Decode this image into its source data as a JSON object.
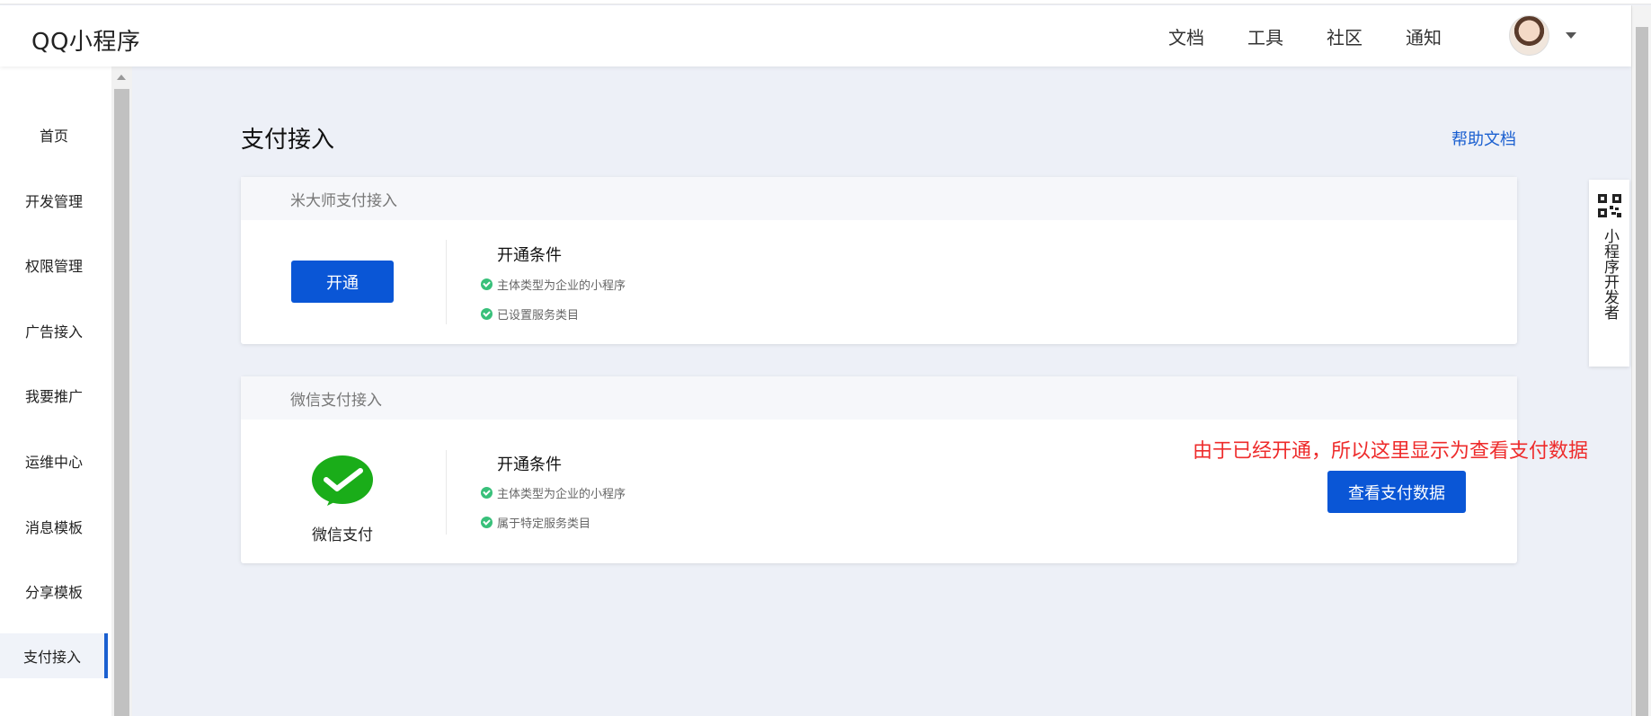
{
  "header": {
    "brand": "QQ小程序",
    "nav": [
      "文档",
      "工具",
      "社区",
      "通知"
    ]
  },
  "sidebar": {
    "items": [
      {
        "label": "首页"
      },
      {
        "label": "开发管理"
      },
      {
        "label": "权限管理"
      },
      {
        "label": "广告接入"
      },
      {
        "label": "我要推广"
      },
      {
        "label": "运维中心"
      },
      {
        "label": "消息模板"
      },
      {
        "label": "分享模板"
      },
      {
        "label": "支付接入",
        "active": true
      }
    ]
  },
  "main": {
    "title": "支付接入",
    "help_link": "帮助文档",
    "cards": [
      {
        "title": "米大师支付接入",
        "button": "开通",
        "conditions_title": "开通条件",
        "conditions": [
          "主体类型为企业的小程序",
          "已设置服务类目"
        ]
      },
      {
        "title": "微信支付接入",
        "logo_label": "微信支付",
        "button": "查看支付数据",
        "conditions_title": "开通条件",
        "conditions": [
          "主体类型为企业的小程序",
          "属于特定服务类目"
        ]
      }
    ],
    "annotation": "由于已经开通，所以这里显示为查看支付数据"
  },
  "float_panel": {
    "text": "小程序开发者",
    "icon": "qr-code-icon"
  },
  "colors": {
    "primary": "#0a56d6",
    "link": "#1a5fd0",
    "check": "#38c07a",
    "annotation": "#ee2b2b",
    "wechat_green": "#1aad19"
  }
}
